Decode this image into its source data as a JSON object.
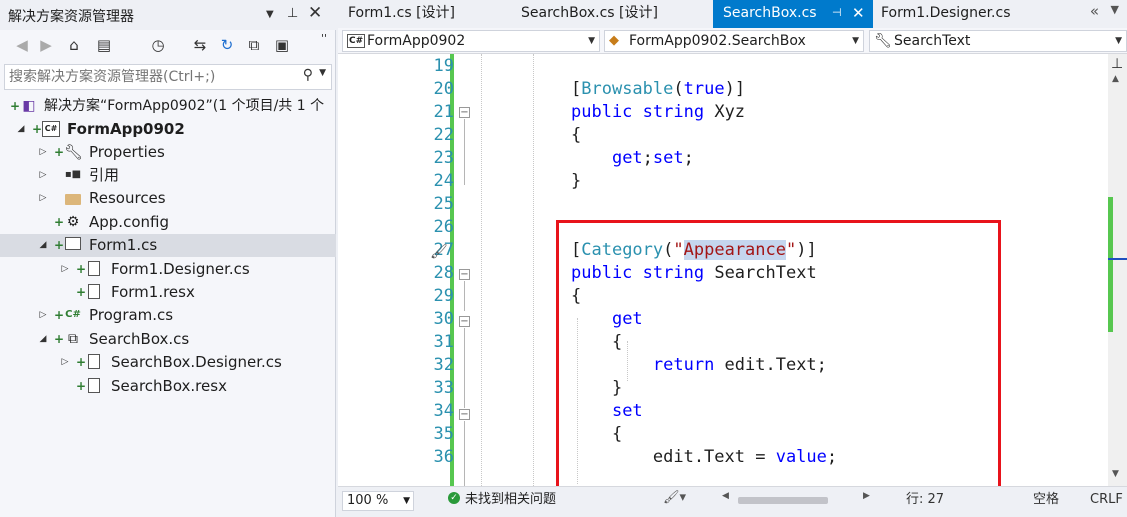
{
  "solution_explorer": {
    "title": "解决方案资源管理器",
    "title_icons": [
      "dropdown-icon",
      "pin-icon",
      "close-icon"
    ],
    "toolbar_icons": [
      "back-icon",
      "forward-icon",
      "home-icon",
      "switch-view-icon",
      "history-icon",
      "sync-icon",
      "refresh-icon",
      "collapse-all-icon",
      "show-all-files-icon",
      "more-icon"
    ],
    "search_placeholder": "搜索解决方案资源管理器(Ctrl+;)",
    "tree": [
      {
        "label": "解决方案“FormApp0902”(1 个项目/共 1 个",
        "icon": "solution-icon"
      },
      {
        "label": "FormApp0902",
        "icon": "csharp-project-icon"
      },
      {
        "label": "Properties",
        "icon": "wrench-icon"
      },
      {
        "label": "引用",
        "icon": "references-icon"
      },
      {
        "label": "Resources",
        "icon": "folder-icon"
      },
      {
        "label": "App.config",
        "icon": "config-file-icon"
      },
      {
        "label": "Form1.cs",
        "icon": "form-icon"
      },
      {
        "label": "Form1.Designer.cs",
        "icon": "file-icon"
      },
      {
        "label": "Form1.resx",
        "icon": "file-icon"
      },
      {
        "label": "Program.cs",
        "icon": "csharp-file-icon"
      },
      {
        "label": "SearchBox.cs",
        "icon": "usercontrol-icon"
      },
      {
        "label": "SearchBox.Designer.cs",
        "icon": "file-icon"
      },
      {
        "label": "SearchBox.resx",
        "icon": "file-icon"
      }
    ]
  },
  "editor": {
    "tabs": [
      {
        "label": "Form1.cs [设计]",
        "active": false
      },
      {
        "label": "SearchBox.cs [设计]",
        "active": false
      },
      {
        "label": "SearchBox.cs",
        "active": true
      },
      {
        "label": "Form1.Designer.cs",
        "active": false
      }
    ],
    "nav": {
      "project": "FormApp0902",
      "class": "FormApp0902.SearchBox",
      "member": "SearchText"
    },
    "lines": [
      {
        "n": "19",
        "text": ""
      },
      {
        "n": "20",
        "text": "[Browsable(true)]"
      },
      {
        "n": "21",
        "text": "public string Xyz"
      },
      {
        "n": "22",
        "text": "{"
      },
      {
        "n": "23",
        "text": "    get;set;"
      },
      {
        "n": "24",
        "text": "}"
      },
      {
        "n": "25",
        "text": ""
      },
      {
        "n": "26",
        "text": ""
      },
      {
        "n": "27",
        "text": "[Category(\"Appearance\")]"
      },
      {
        "n": "28",
        "text": "public string SearchText"
      },
      {
        "n": "29",
        "text": "{"
      },
      {
        "n": "30",
        "text": "    get"
      },
      {
        "n": "31",
        "text": "    {"
      },
      {
        "n": "32",
        "text": "        return edit.Text;"
      },
      {
        "n": "33",
        "text": "    }"
      },
      {
        "n": "34",
        "text": "    set"
      },
      {
        "n": "35",
        "text": "    {"
      },
      {
        "n": "36",
        "text": "        edit.Text = value;"
      }
    ],
    "colors": {
      "keyword": "#0000ff",
      "type": "#2b91af",
      "string": "#a31515",
      "line_number": "#2b91af",
      "active_tab": "#007acc",
      "highlight_box": "#e8131b",
      "change_bar": "#57c750"
    }
  },
  "status_bar": {
    "zoom": "100 %",
    "issues": "未找到相关问题",
    "position": "行: 27",
    "encoding": "空格",
    "line_ending": "CRLF"
  }
}
